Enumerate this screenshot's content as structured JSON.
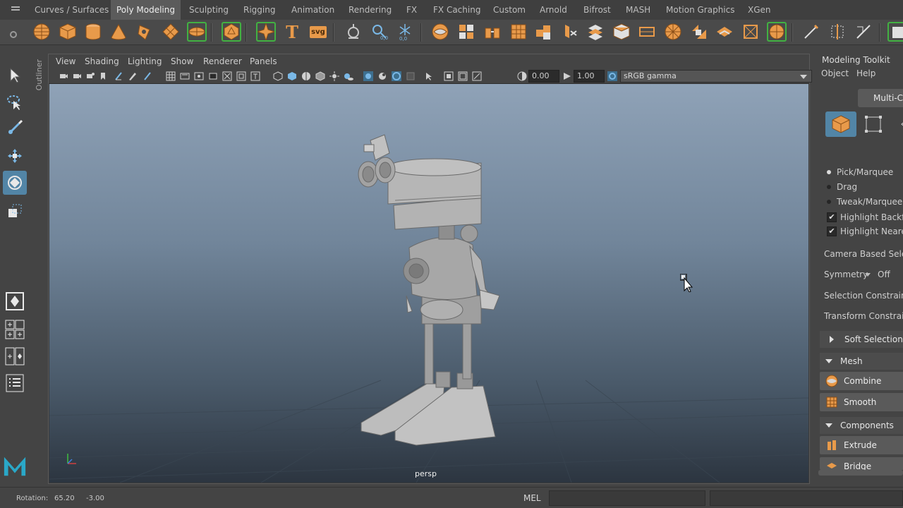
{
  "shelf": {
    "tabs": [
      {
        "label": "Curves / Surfaces",
        "active": false
      },
      {
        "label": "Poly Modeling",
        "active": true
      },
      {
        "label": "Sculpting",
        "active": false
      },
      {
        "label": "Rigging",
        "active": false
      },
      {
        "label": "Animation",
        "active": false
      },
      {
        "label": "Rendering",
        "active": false
      },
      {
        "label": "FX",
        "active": false
      },
      {
        "label": "FX Caching",
        "active": false
      },
      {
        "label": "Custom",
        "active": false
      },
      {
        "label": "Arnold",
        "active": false
      },
      {
        "label": "Bifrost",
        "active": false
      },
      {
        "label": "MASH",
        "active": false
      },
      {
        "label": "Motion Graphics",
        "active": false
      },
      {
        "label": "XGen",
        "active": false
      }
    ],
    "icons": [
      "poly-sphere-icon",
      "poly-cube-icon",
      "poly-cylinder-icon",
      "poly-cone-icon",
      "poly-torus-icon",
      "poly-plane-icon",
      "poly-disc-icon",
      "platonic-solid-icon",
      "super-shape-icon",
      "type-text-icon",
      "svg-icon",
      "sculpt-icon",
      "soft-select-icon",
      "snowflake-icon",
      "combine-icon",
      "separate-icon",
      "extract-icon",
      "smooth-icon",
      "boolean-union-icon",
      "mirror-icon",
      "bevel-icon",
      "bridge-icon",
      "extrude-icon",
      "append-polygon-icon",
      "fill-hole-icon",
      "multi-cut-icon",
      "target-weld-icon",
      "bevel-edge-icon",
      "extrude-face-icon",
      "uv-editor-icon",
      "planar-map-icon",
      "automatic-map-icon",
      "brush-icon",
      "move-pivot-icon",
      "ruler-icon"
    ],
    "icon_label_text": "T",
    "icon_label_svg": "svg",
    "accent_color": "#e89a4a",
    "highlight_color": "#42b142"
  },
  "viewport": {
    "menus": [
      "View",
      "Shading",
      "Lighting",
      "Show",
      "Renderer",
      "Panels"
    ],
    "exposure": "0.00",
    "gamma": "1.00",
    "color_space": "sRGB gamma",
    "camera": "persp",
    "outliner_label": "Outliner"
  },
  "toolkit": {
    "title": "Modeling Toolkit",
    "menus": [
      "Object",
      "Help"
    ],
    "multi_component": "Multi-Co",
    "pick_marquee": "Pick/Marquee",
    "drag": "Drag",
    "tweak_marquee": "Tweak/Marquee",
    "highlight_backfaces": "Highlight Backfa",
    "highlight_nearest": "Highlight Neares",
    "camera_based_selection": "Camera Based Selecti",
    "symmetry_label": "Symmetry",
    "symmetry_value": "Off",
    "selection_constraint": "Selection Constraint",
    "transform_constraint": "Transform Constraint",
    "soft_selection": "Soft Selection",
    "mesh_section": "Mesh",
    "combine": "Combine",
    "smooth": "Smooth",
    "components_section": "Components",
    "extrude": "Extrude",
    "bridge": "Bridge"
  },
  "helpline": {
    "rotation_label": "Rotation:",
    "rotation_x": "65.20",
    "rotation_y": "-3.00",
    "mel_label": "MEL"
  }
}
